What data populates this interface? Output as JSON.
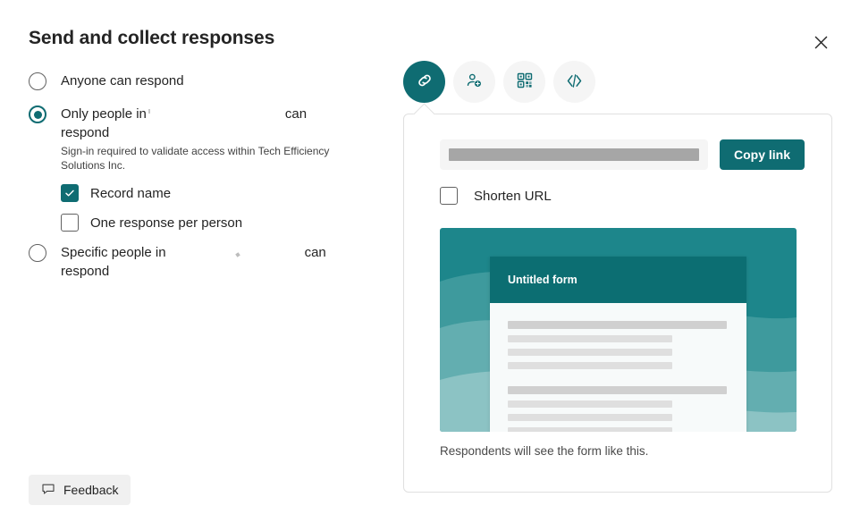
{
  "dialog": {
    "title": "Send and collect responses",
    "close_icon": "close-icon"
  },
  "audience": {
    "options": [
      {
        "id": "anyone",
        "label": "Anyone can respond",
        "selected": false
      },
      {
        "id": "only-people-in-org",
        "label_prefix": "Only people in",
        "label_suffix": "can respond",
        "selected": true,
        "hint": "Sign-in required to validate access within Tech Efficiency Solutions Inc."
      },
      {
        "id": "specific-people",
        "label_prefix": "Specific people in",
        "label_suffix": "can respond",
        "selected": false
      }
    ],
    "sub_options": [
      {
        "id": "record-name",
        "label": "Record name",
        "checked": true
      },
      {
        "id": "one-response-per-person",
        "label": "One response per person",
        "checked": false
      }
    ]
  },
  "feedback": {
    "label": "Feedback",
    "icon": "comment-icon"
  },
  "share": {
    "tabs": [
      {
        "id": "link",
        "icon": "link-icon",
        "active": true
      },
      {
        "id": "invite",
        "icon": "person-add-icon",
        "active": false
      },
      {
        "id": "qr",
        "icon": "qr-code-icon",
        "active": false
      },
      {
        "id": "embed",
        "icon": "code-icon",
        "active": false
      }
    ],
    "link_field_value": "",
    "copy_label": "Copy link",
    "shorten_url": {
      "label": "Shorten URL",
      "checked": false
    },
    "preview": {
      "form_title": "Untitled form",
      "caption": "Respondents will see the form like this."
    }
  },
  "colors": {
    "accent": "#0F6C72",
    "accent_dark": "#0C5A5F",
    "form_header": "#0C6E72",
    "redaction": "#A6A6A6",
    "field_bg": "#F5F5F5"
  }
}
